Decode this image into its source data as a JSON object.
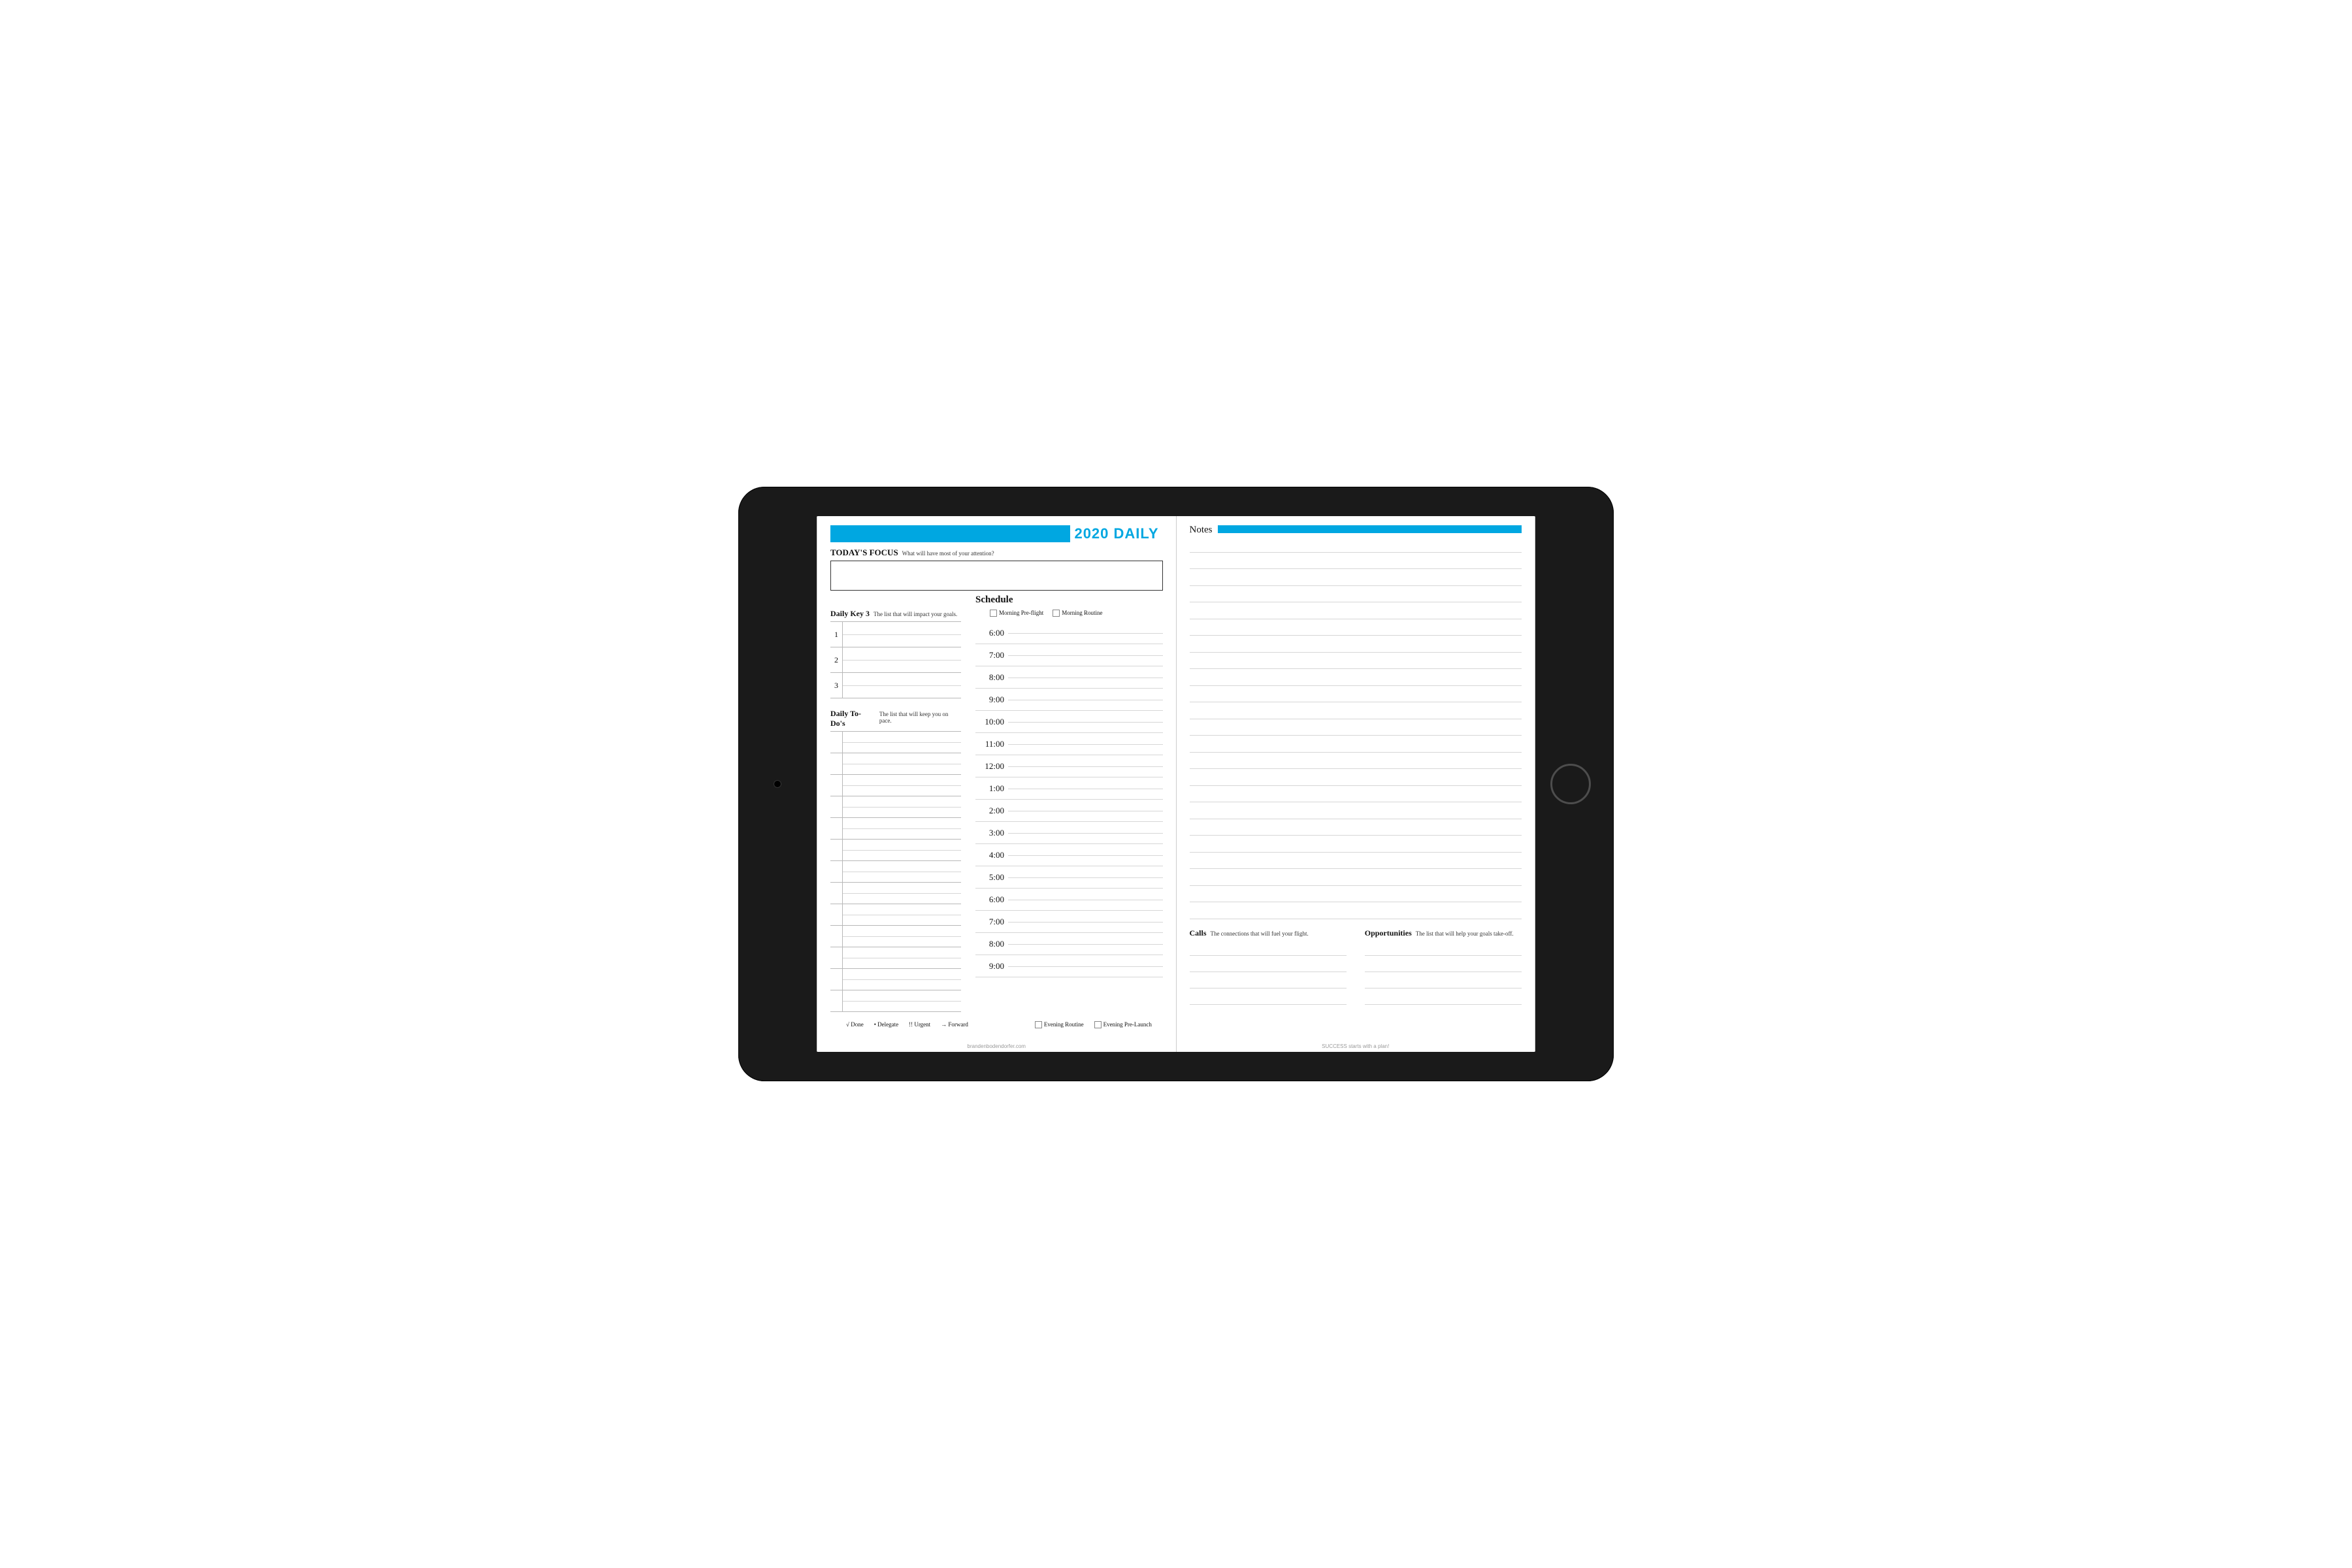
{
  "header": {
    "title": "2020 DAILY"
  },
  "focus": {
    "title": "TODAY'S FOCUS",
    "subtitle": "What will have most of your attention?"
  },
  "key3": {
    "title": "Daily Key 3",
    "subtitle": "The list that will impact your goals.",
    "numbers": [
      "1",
      "2",
      "3"
    ]
  },
  "todos": {
    "title": "Daily To-Do's",
    "subtitle": "The list that will keep you on pace.",
    "row_count": 13
  },
  "schedule": {
    "title": "Schedule",
    "morning_checks": [
      "Morning Pre-flight",
      "Morning Routine"
    ],
    "times": [
      "6:00",
      "7:00",
      "8:00",
      "9:00",
      "10:00",
      "11:00",
      "12:00",
      "1:00",
      "2:00",
      "3:00",
      "4:00",
      "5:00",
      "6:00",
      "7:00",
      "8:00",
      "9:00"
    ],
    "evening_checks": [
      "Evening Routine",
      "Evening Pre-Launch"
    ]
  },
  "legend": {
    "done": "√ Done",
    "delegate": "• Delegate",
    "urgent": "!! Urgent",
    "forward": "→ Forward"
  },
  "notes": {
    "title": "Notes",
    "line_count": 23
  },
  "calls": {
    "title": "Calls",
    "subtitle": "The connections that will fuel your flight.",
    "line_count": 4
  },
  "opportunities": {
    "title": "Opportunities",
    "subtitle": "The list that will help your goals take-off.",
    "line_count": 4
  },
  "footer_left": "brandenbodendorfer.com",
  "footer_right": "SUCCESS starts with a plan!"
}
